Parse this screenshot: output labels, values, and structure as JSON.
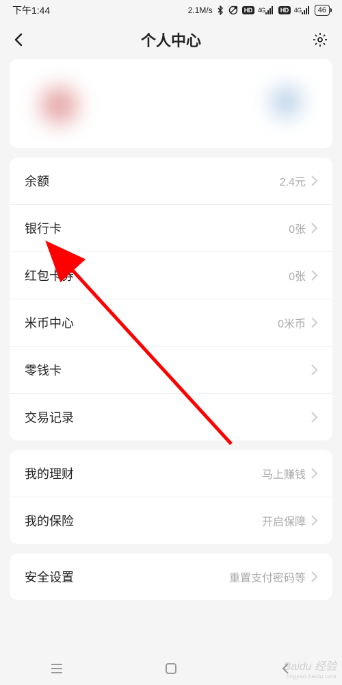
{
  "status_bar": {
    "time": "下午1:44",
    "speed": "2.1M/s",
    "battery": "46"
  },
  "nav": {
    "title": "个人中心"
  },
  "section1": {
    "items": [
      {
        "label": "余额",
        "value": "2.4元"
      },
      {
        "label": "银行卡",
        "value": "0张"
      },
      {
        "label": "红包卡券",
        "value": "0张"
      },
      {
        "label": "米币中心",
        "value": "0米币"
      },
      {
        "label": "零钱卡",
        "value": ""
      },
      {
        "label": "交易记录",
        "value": ""
      }
    ]
  },
  "section2": {
    "items": [
      {
        "label": "我的理财",
        "value": "马上赚钱"
      },
      {
        "label": "我的保险",
        "value": "开启保障"
      }
    ]
  },
  "section3": {
    "items": [
      {
        "label": "安全设置",
        "value": "重置支付密码等"
      }
    ]
  },
  "watermark": {
    "main": "Baidu 经验",
    "sub": "jingyan.baidu.com"
  }
}
